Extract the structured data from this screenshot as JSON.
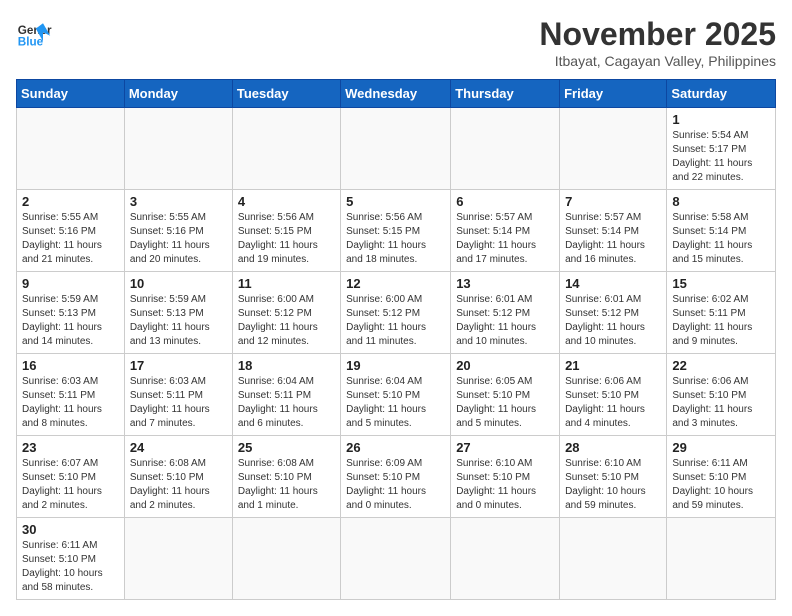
{
  "logo": {
    "text_general": "General",
    "text_blue": "Blue"
  },
  "title": "November 2025",
  "subtitle": "Itbayat, Cagayan Valley, Philippines",
  "days_of_week": [
    "Sunday",
    "Monday",
    "Tuesday",
    "Wednesday",
    "Thursday",
    "Friday",
    "Saturday"
  ],
  "weeks": [
    [
      {
        "day": "",
        "info": ""
      },
      {
        "day": "",
        "info": ""
      },
      {
        "day": "",
        "info": ""
      },
      {
        "day": "",
        "info": ""
      },
      {
        "day": "",
        "info": ""
      },
      {
        "day": "",
        "info": ""
      },
      {
        "day": "1",
        "info": "Sunrise: 5:54 AM\nSunset: 5:17 PM\nDaylight: 11 hours and 22 minutes."
      }
    ],
    [
      {
        "day": "2",
        "info": "Sunrise: 5:55 AM\nSunset: 5:16 PM\nDaylight: 11 hours and 21 minutes."
      },
      {
        "day": "3",
        "info": "Sunrise: 5:55 AM\nSunset: 5:16 PM\nDaylight: 11 hours and 20 minutes."
      },
      {
        "day": "4",
        "info": "Sunrise: 5:56 AM\nSunset: 5:15 PM\nDaylight: 11 hours and 19 minutes."
      },
      {
        "day": "5",
        "info": "Sunrise: 5:56 AM\nSunset: 5:15 PM\nDaylight: 11 hours and 18 minutes."
      },
      {
        "day": "6",
        "info": "Sunrise: 5:57 AM\nSunset: 5:14 PM\nDaylight: 11 hours and 17 minutes."
      },
      {
        "day": "7",
        "info": "Sunrise: 5:57 AM\nSunset: 5:14 PM\nDaylight: 11 hours and 16 minutes."
      },
      {
        "day": "8",
        "info": "Sunrise: 5:58 AM\nSunset: 5:14 PM\nDaylight: 11 hours and 15 minutes."
      }
    ],
    [
      {
        "day": "9",
        "info": "Sunrise: 5:59 AM\nSunset: 5:13 PM\nDaylight: 11 hours and 14 minutes."
      },
      {
        "day": "10",
        "info": "Sunrise: 5:59 AM\nSunset: 5:13 PM\nDaylight: 11 hours and 13 minutes."
      },
      {
        "day": "11",
        "info": "Sunrise: 6:00 AM\nSunset: 5:12 PM\nDaylight: 11 hours and 12 minutes."
      },
      {
        "day": "12",
        "info": "Sunrise: 6:00 AM\nSunset: 5:12 PM\nDaylight: 11 hours and 11 minutes."
      },
      {
        "day": "13",
        "info": "Sunrise: 6:01 AM\nSunset: 5:12 PM\nDaylight: 11 hours and 10 minutes."
      },
      {
        "day": "14",
        "info": "Sunrise: 6:01 AM\nSunset: 5:12 PM\nDaylight: 11 hours and 10 minutes."
      },
      {
        "day": "15",
        "info": "Sunrise: 6:02 AM\nSunset: 5:11 PM\nDaylight: 11 hours and 9 minutes."
      }
    ],
    [
      {
        "day": "16",
        "info": "Sunrise: 6:03 AM\nSunset: 5:11 PM\nDaylight: 11 hours and 8 minutes."
      },
      {
        "day": "17",
        "info": "Sunrise: 6:03 AM\nSunset: 5:11 PM\nDaylight: 11 hours and 7 minutes."
      },
      {
        "day": "18",
        "info": "Sunrise: 6:04 AM\nSunset: 5:11 PM\nDaylight: 11 hours and 6 minutes."
      },
      {
        "day": "19",
        "info": "Sunrise: 6:04 AM\nSunset: 5:10 PM\nDaylight: 11 hours and 5 minutes."
      },
      {
        "day": "20",
        "info": "Sunrise: 6:05 AM\nSunset: 5:10 PM\nDaylight: 11 hours and 5 minutes."
      },
      {
        "day": "21",
        "info": "Sunrise: 6:06 AM\nSunset: 5:10 PM\nDaylight: 11 hours and 4 minutes."
      },
      {
        "day": "22",
        "info": "Sunrise: 6:06 AM\nSunset: 5:10 PM\nDaylight: 11 hours and 3 minutes."
      }
    ],
    [
      {
        "day": "23",
        "info": "Sunrise: 6:07 AM\nSunset: 5:10 PM\nDaylight: 11 hours and 2 minutes."
      },
      {
        "day": "24",
        "info": "Sunrise: 6:08 AM\nSunset: 5:10 PM\nDaylight: 11 hours and 2 minutes."
      },
      {
        "day": "25",
        "info": "Sunrise: 6:08 AM\nSunset: 5:10 PM\nDaylight: 11 hours and 1 minute."
      },
      {
        "day": "26",
        "info": "Sunrise: 6:09 AM\nSunset: 5:10 PM\nDaylight: 11 hours and 0 minutes."
      },
      {
        "day": "27",
        "info": "Sunrise: 6:10 AM\nSunset: 5:10 PM\nDaylight: 11 hours and 0 minutes."
      },
      {
        "day": "28",
        "info": "Sunrise: 6:10 AM\nSunset: 5:10 PM\nDaylight: 10 hours and 59 minutes."
      },
      {
        "day": "29",
        "info": "Sunrise: 6:11 AM\nSunset: 5:10 PM\nDaylight: 10 hours and 59 minutes."
      }
    ],
    [
      {
        "day": "30",
        "info": "Sunrise: 6:11 AM\nSunset: 5:10 PM\nDaylight: 10 hours and 58 minutes."
      },
      {
        "day": "",
        "info": ""
      },
      {
        "day": "",
        "info": ""
      },
      {
        "day": "",
        "info": ""
      },
      {
        "day": "",
        "info": ""
      },
      {
        "day": "",
        "info": ""
      },
      {
        "day": "",
        "info": ""
      }
    ]
  ]
}
